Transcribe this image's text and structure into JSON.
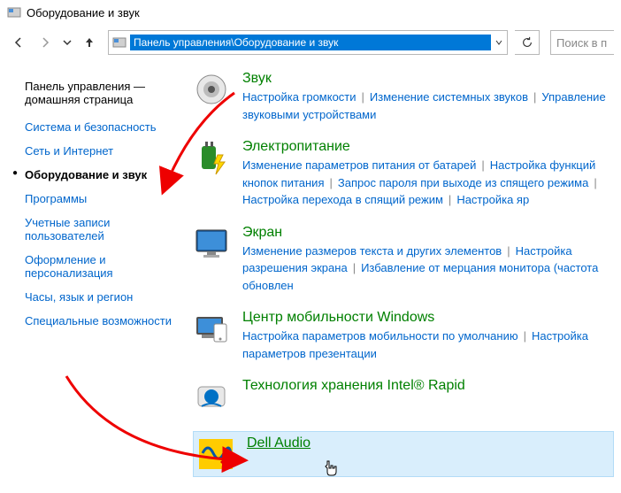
{
  "window": {
    "title": "Оборудование и звук"
  },
  "addressbar": {
    "path": "Панель управления\\Оборудование и звук"
  },
  "search": {
    "placeholder": "Поиск в п"
  },
  "sidebar": {
    "home": "Панель управления — домашняя страница",
    "items": [
      "Система и безопасность",
      "Сеть и Интернет",
      "Оборудование и звук",
      "Программы",
      "Учетные записи пользователей",
      "Оформление и персонализация",
      "Часы, язык и регион",
      "Специальные возможности"
    ],
    "active_index": 2
  },
  "categories": [
    {
      "title": "Звук",
      "icon": "speaker-icon",
      "links": [
        "Настройка громкости",
        "Изменение системных звуков",
        "Управление звуковыми устройствами"
      ]
    },
    {
      "title": "Электропитание",
      "icon": "power-icon",
      "links": [
        "Изменение параметров питания от батарей",
        "Настройка функций кнопок питания",
        "Запрос пароля при выходе из спящего режима",
        "Настройка перехода в спящий режим",
        "Настройка яр"
      ]
    },
    {
      "title": "Экран",
      "icon": "monitor-icon",
      "links": [
        "Изменение размеров текста и других элементов",
        "Настройка разрешения экрана",
        "Избавление от мерцания монитора (частота обновлен"
      ]
    },
    {
      "title": "Центр мобильности Windows",
      "icon": "mobility-icon",
      "links": [
        "Настройка параметров мобильности по умолчанию",
        "Настройка параметров презентации"
      ]
    },
    {
      "title": "Технология хранения Intel® Rapid",
      "icon": "intel-rapid-icon",
      "links": []
    },
    {
      "title": "Dell Audio",
      "icon": "dell-audio-icon",
      "links": [],
      "highlighted": true
    }
  ]
}
